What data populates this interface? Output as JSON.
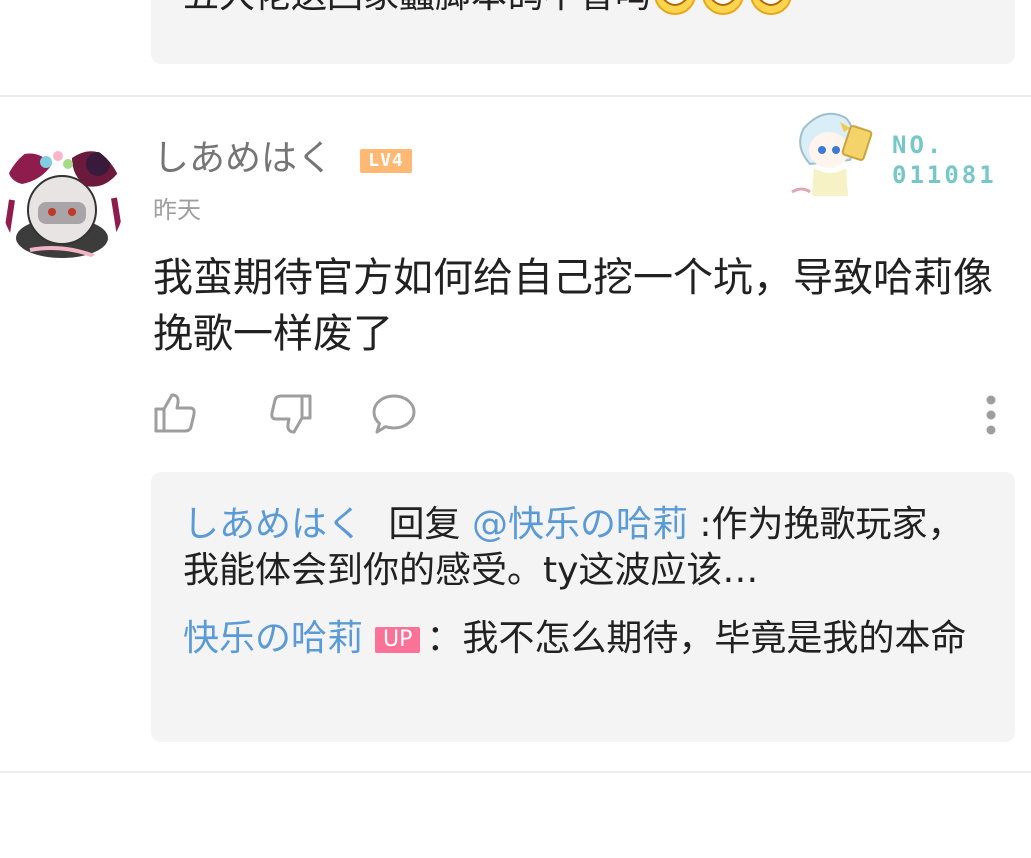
{
  "previous_comment": {
    "text_fragment": "五大佬送回家蠢脚本鸽不香吗",
    "emojis": [
      "grin-emoji",
      "grin-emoji",
      "grin-emoji"
    ]
  },
  "comment": {
    "username": "しあめはく",
    "level": "LV4",
    "time": "昨天",
    "fan_card_number": "NO.\n011081",
    "content": "我蛮期待官方如何给自己挖一个坑，导致哈莉像挽歌一样废了",
    "actions": {
      "like_icon": "thumbs-up-icon",
      "dislike_icon": "thumbs-down-icon",
      "reply_icon": "comment-bubble-icon",
      "more_icon": "more-vertical-icon"
    }
  },
  "replies": [
    {
      "user": "しあめはく",
      "action": "回复",
      "mention": "@快乐の哈莉",
      "text": ":作为挽歌玩家，我能体会到你的感受。ty这波应该…"
    },
    {
      "user": "快乐の哈莉",
      "badge": "UP",
      "separator": "：",
      "text": "我不怎么期待，毕竟是我的本命"
    }
  ],
  "colors": {
    "link_blue": "#5a9bd5",
    "level_orange": "#ffb974",
    "up_pink": "#fb7299",
    "fan_teal": "#77c7c9",
    "box_bg": "#f4f4f4"
  }
}
